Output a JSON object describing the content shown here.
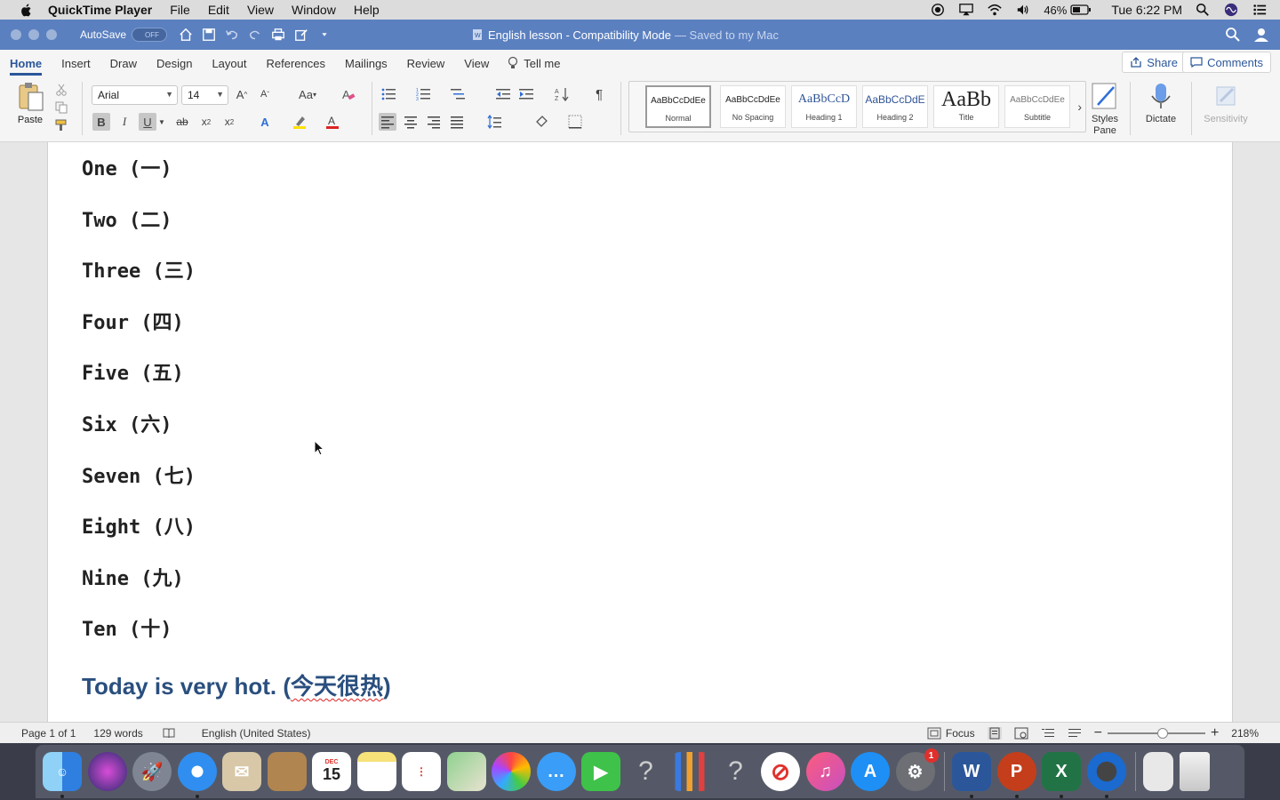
{
  "menubar": {
    "app_name": "QuickTime Player",
    "items": [
      "File",
      "Edit",
      "View",
      "Window",
      "Help"
    ],
    "battery": "46%",
    "clock": "Tue 6:22 PM"
  },
  "titlebar": {
    "autosave_label": "AutoSave",
    "autosave_state": "OFF",
    "doc_name": "English lesson",
    "separator": " - ",
    "mode": "Compatibility Mode",
    "saved": "— Saved to my Mac"
  },
  "tabs": {
    "items": [
      "Home",
      "Insert",
      "Draw",
      "Design",
      "Layout",
      "References",
      "Mailings",
      "Review",
      "View"
    ],
    "tell_me": "Tell me",
    "share": "Share",
    "comments": "Comments"
  },
  "ribbon": {
    "paste_label": "Paste",
    "font_name": "Arial",
    "font_size": "14",
    "styles": [
      {
        "preview": "AaBbCcDdEe",
        "name": "Normal"
      },
      {
        "preview": "AaBbCcDdEe",
        "name": "No Spacing"
      },
      {
        "preview": "AaBbCcD",
        "name": "Heading 1"
      },
      {
        "preview": "AaBbCcDdE",
        "name": "Heading 2"
      },
      {
        "preview": "AaBb",
        "name": "Title"
      },
      {
        "preview": "AaBbCcDdEe",
        "name": "Subtitle"
      }
    ],
    "styles_pane": "Styles Pane",
    "dictate": "Dictate",
    "sensitivity": "Sensitivity"
  },
  "document": {
    "lines": [
      "One (一)",
      "Two (二)",
      "Three (三)",
      "Four (四)",
      "Five (五)",
      "Six (六)",
      "Seven (七)",
      "Eight (八)",
      "Nine (九)",
      "Ten (十)"
    ],
    "sentence_en": "Today is very hot. (",
    "sentence_zh": "今天很热",
    "sentence_end": ")"
  },
  "statusbar": {
    "page": "Page 1 of 1",
    "words": "129 words",
    "language": "English (United States)",
    "focus": "Focus",
    "zoom": "218%"
  },
  "dock": {
    "calendar_month": "DEC",
    "calendar_day": "15",
    "settings_badge": "1",
    "apps": [
      "finder",
      "siri",
      "launchpad",
      "safari",
      "mail",
      "contacts",
      "calendar",
      "notes",
      "reminders",
      "maps",
      "photos",
      "messages",
      "facetime",
      "unknown",
      "numbers",
      "unknown",
      "news",
      "music",
      "app-store",
      "system-preferences",
      "word",
      "powerpoint",
      "excel",
      "quicktime",
      "downloads",
      "trash"
    ]
  }
}
